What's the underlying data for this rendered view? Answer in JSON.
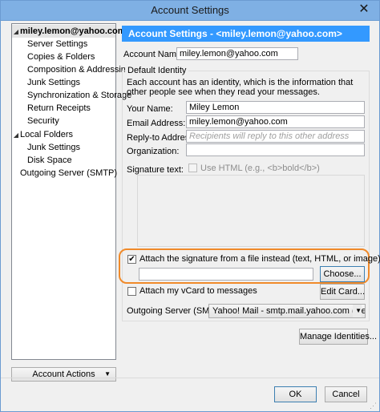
{
  "window": {
    "title": "Account Settings",
    "close_glyph": "✕"
  },
  "tree": {
    "items": [
      {
        "label": "miley.lemon@yahoo.com",
        "level": 0,
        "expanded": true,
        "selected": true
      },
      {
        "label": "Server Settings",
        "level": 1
      },
      {
        "label": "Copies & Folders",
        "level": 1
      },
      {
        "label": "Composition & Addressing",
        "level": 1
      },
      {
        "label": "Junk Settings",
        "level": 1
      },
      {
        "label": "Synchronization & Storage",
        "level": 1
      },
      {
        "label": "Return Receipts",
        "level": 1
      },
      {
        "label": "Security",
        "level": 1
      },
      {
        "label": "Local Folders",
        "level": 0,
        "expanded": true
      },
      {
        "label": "Junk Settings",
        "level": 1
      },
      {
        "label": "Disk Space",
        "level": 1
      },
      {
        "label": "Outgoing Server (SMTP)",
        "level": 0
      }
    ],
    "account_actions_label": "Account Actions"
  },
  "header": {
    "title": "Account Settings - <miley.lemon@yahoo.com>"
  },
  "account_name": {
    "label": "Account Name:",
    "value": "miley.lemon@yahoo.com"
  },
  "identity": {
    "group_title": "Default Identity",
    "description": "Each account has an identity, which is the information that other people see when they read your messages.",
    "your_name": {
      "label": "Your Name:",
      "value": "Miley Lemon"
    },
    "email": {
      "label": "Email Address:",
      "value": "miley.lemon@yahoo.com"
    },
    "reply_to": {
      "label": "Reply-to Address:",
      "placeholder": "Recipients will reply to this other address"
    },
    "organization": {
      "label": "Organization:",
      "value": ""
    },
    "signature_text": {
      "label": "Signature text:",
      "use_html_label": "Use HTML (e.g., <b>bold</b>)",
      "use_html_checked": false
    },
    "attach_file": {
      "label": "Attach the signature from a file instead (text, HTML, or image):",
      "checked": true,
      "path": "",
      "choose_label": "Choose..."
    },
    "vcard": {
      "label": "Attach my vCard to messages",
      "checked": false,
      "edit_label": "Edit Card..."
    },
    "outgoing_server": {
      "label": "Outgoing Server (SMTP):",
      "value": "Yahoo! Mail - smtp.mail.yahoo.com (Default)"
    },
    "manage_identities_label": "Manage Identities..."
  },
  "footer": {
    "ok_label": "OK",
    "cancel_label": "Cancel"
  },
  "colors": {
    "header_bg": "#3399ff",
    "highlight": "#f08a2a",
    "titlebar": "#7fb0e4"
  }
}
